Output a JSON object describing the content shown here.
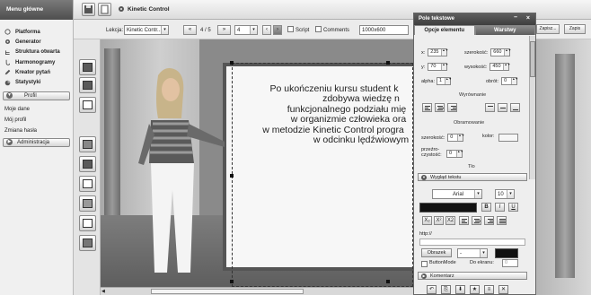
{
  "left_menu": {
    "header": "Menu główne",
    "items": [
      {
        "label": "Platforma",
        "icon": "circle-icon"
      },
      {
        "label": "Generator",
        "icon": "gear-icon"
      },
      {
        "label": "Struktura otwarta",
        "icon": "tree-icon"
      },
      {
        "label": "Harmonogramy",
        "icon": "hook-icon"
      },
      {
        "label": "Kreator pytań",
        "icon": "pencil-icon"
      },
      {
        "label": "Statystyki",
        "icon": "pie-chart-icon"
      }
    ],
    "profile_section": "Profil",
    "profile_items": [
      "Moje dane",
      "Mój profil",
      "Zmiana hasła"
    ],
    "admin_section": "Administracja"
  },
  "toolbar": {
    "title": "Kinetic Control"
  },
  "lesson_bar": {
    "lesson_label": "Lekcja:",
    "lesson_value": "Kinetic Contr...",
    "page_counter": "4 / 5",
    "page_select": "4",
    "script_label": "Script",
    "comments_label": "Comments",
    "resolution_value": "1000x600",
    "right_button_1": "Zapisz...",
    "right_button_2": "Zapis"
  },
  "slide": {
    "text_lines": [
      "Po ukończeniu  kursu student k",
      "zdobywa wiedzę n",
      "funkcjonalnego podziału mię",
      "w organizmie człowieka ora",
      "w metodzie Kinetic Control progra",
      "w odcinku lędźwiowym"
    ]
  },
  "panel": {
    "title": "Pole tekstowe",
    "tabs": [
      "Opcje elementu",
      "Warstwy"
    ],
    "x_label": "x:",
    "x_value": "235",
    "width_label": "szerokość:",
    "width_value": "660",
    "y_label": "y:",
    "y_value": "70",
    "height_label": "wysokość:",
    "height_value": "450",
    "alpha_label": "alpha:",
    "alpha_value": "1",
    "rotation_label": "obrót:",
    "rotation_value": "0",
    "alignment_section": "Wyrównanie",
    "border_section": "Obramowanie",
    "border_width_label": "szerokość:",
    "border_width_value": "0",
    "color_label": "kolor:",
    "transparency_label": "przeźro-\nczystość:",
    "transparency_value": "0",
    "background_label": "Tło",
    "appearance_section": "Wygląd tekstu",
    "font_value": "Arial",
    "font_size_value": "10",
    "format_buttons": [
      "B",
      "I",
      "U"
    ],
    "link_label": "http://",
    "image_button": "Obrazek",
    "button_mode_label": "ButtonMode",
    "to_screen_label": "Do ekranu:",
    "to_screen_value": "0",
    "comment_section": "Komentarz"
  }
}
